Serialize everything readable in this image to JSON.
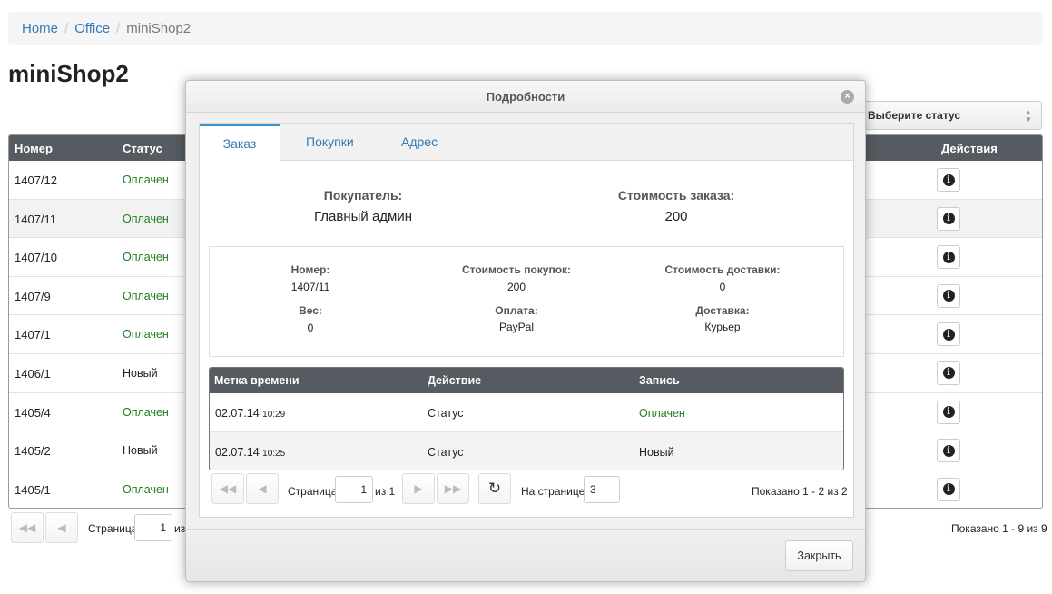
{
  "breadcrumb": {
    "home": "Home",
    "office": "Office",
    "current": "miniShop2"
  },
  "page_title": "miniShop2",
  "status_select": {
    "placeholder": "Выберите статус"
  },
  "table": {
    "headers": {
      "number": "Номер",
      "status": "Статус",
      "actions": "Действия"
    },
    "rows": [
      {
        "number": "1407/12",
        "status": "Оплачен"
      },
      {
        "number": "1407/11",
        "status": "Оплачен"
      },
      {
        "number": "1407/10",
        "status": "Оплачен"
      },
      {
        "number": "1407/9",
        "status": "Оплачен"
      },
      {
        "number": "1407/1",
        "status": "Оплачен"
      },
      {
        "number": "1406/1",
        "status": "Новый"
      },
      {
        "number": "1405/4",
        "status": "Оплачен"
      },
      {
        "number": "1405/2",
        "status": "Новый"
      },
      {
        "number": "1405/1",
        "status": "Оплачен"
      }
    ]
  },
  "pagination": {
    "page_label": "Страница",
    "page_value": "1",
    "of_label": "из",
    "shown": "Показано 1 - 9 из 9"
  },
  "modal": {
    "title": "Подробности",
    "tabs": {
      "order": "Заказ",
      "purchases": "Покупки",
      "address": "Адрес"
    },
    "customer_label": "Покупатель:",
    "customer_value": "Главный админ",
    "order_cost_label": "Стоимость заказа:",
    "order_cost_value": "200",
    "details": {
      "number_label": "Номер:",
      "number_value": "1407/11",
      "items_cost_label": "Стоимость покупок:",
      "items_cost_value": "200",
      "delivery_cost_label": "Стоимость доставки:",
      "delivery_cost_value": "0",
      "weight_label": "Вес:",
      "weight_value": "0",
      "payment_label": "Оплата:",
      "payment_value": "PayPal",
      "delivery_label": "Доставка:",
      "delivery_value": "Курьер"
    },
    "log": {
      "headers": {
        "timestamp": "Метка времени",
        "action": "Действие",
        "entry": "Запись"
      },
      "rows": [
        {
          "date": "02.07.14",
          "time": "10:29",
          "action": "Статус",
          "entry": "Оплачен"
        },
        {
          "date": "02.07.14",
          "time": "10:25",
          "action": "Статус",
          "entry": "Новый"
        }
      ]
    },
    "pagination": {
      "page_label": "Страница",
      "page_value": "1",
      "of_text": "из 1",
      "per_page_label": "На странице:",
      "per_page_value": "3",
      "shown": "Показано 1 - 2 из 2"
    },
    "close_label": "Закрыть"
  },
  "colors": {
    "paid": "#1f7e1f",
    "link": "#337ab7",
    "header_bg": "#555b61"
  }
}
